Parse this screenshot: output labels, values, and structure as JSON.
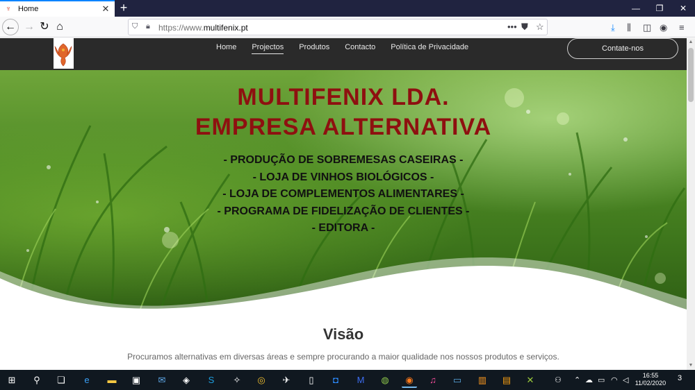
{
  "browser": {
    "tab_title": "Home",
    "url_prefix": "https://www.",
    "url_domain": "multifenix.pt"
  },
  "site": {
    "nav": [
      {
        "label": "Home"
      },
      {
        "label": "Projectos"
      },
      {
        "label": "Produtos"
      },
      {
        "label": "Contacto"
      },
      {
        "label": "Política de Privacidade"
      }
    ],
    "contact_button": "Contate-nos",
    "hero": {
      "title_line1": "MULTIFENIX LDA.",
      "title_line2": "EMPRESA ALTERNATIVA",
      "lines": [
        "- PRODUÇÃO DE SOBREMESAS CASEIRAS -",
        "- LOJA DE VINHOS BIOLÓGICOS -",
        "- LOJA DE COMPLEMENTOS ALIMENTARES -",
        "- PROGRAMA DE FIDELIZAÇÃO DE CLIENTES -",
        "- EDITORA -"
      ]
    },
    "section": {
      "title": "Visão",
      "text": "Procuramos alternativas em diversas áreas e sempre procurando a maior qualidade nos nossos produtos e serviços."
    }
  },
  "taskbar": {
    "time": "16:55",
    "date": "11/02/2020",
    "notifications": "3"
  },
  "colors": {
    "hero_title": "#8e1010",
    "header_bg": "#2a2a2a",
    "taskbar_bg": "#101820"
  }
}
